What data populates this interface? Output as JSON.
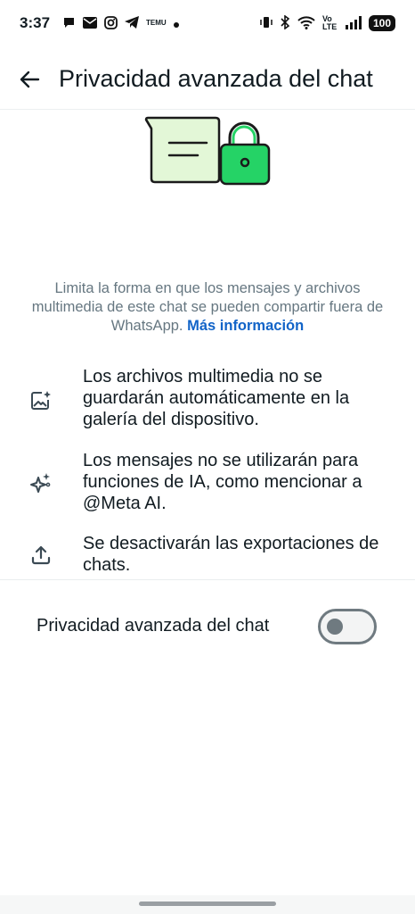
{
  "status_bar": {
    "time": "3:37",
    "battery": "100",
    "left_icons": [
      "chat-bubble-icon",
      "mail-icon",
      "instagram-icon",
      "telegram-icon",
      "temu-icon",
      "dot-icon"
    ],
    "right_icons": [
      "vibrate-icon",
      "bluetooth-icon",
      "wifi-icon",
      "volte-icon",
      "signal-icon"
    ],
    "temu_label": "TEMU",
    "volte_label": "Vo LTE"
  },
  "app_bar": {
    "title": "Privacidad avanzada del chat",
    "back_icon": "arrow-back-icon"
  },
  "description": {
    "text": "Limita la forma en que los mensajes y archivos multimedia de este chat se pueden compartir fuera de WhatsApp.",
    "link": "Más información"
  },
  "features": [
    {
      "icon": "image-sparkle-icon",
      "text": "Los archivos multimedia no se guardarán automáticamente en la galería del dispositivo."
    },
    {
      "icon": "ai-sparkle-icon",
      "text": "Los mensajes no se utilizarán para funciones de IA, como mencionar a @Meta AI."
    },
    {
      "icon": "upload-icon",
      "text": "Se desactivarán las exportaciones de chats."
    }
  ],
  "toggle": {
    "label": "Privacidad avanzada del chat",
    "on": false
  },
  "colors": {
    "accent_green": "#25d366",
    "link_blue": "#1264c8",
    "illustration_fill": "#e3f7d7"
  }
}
